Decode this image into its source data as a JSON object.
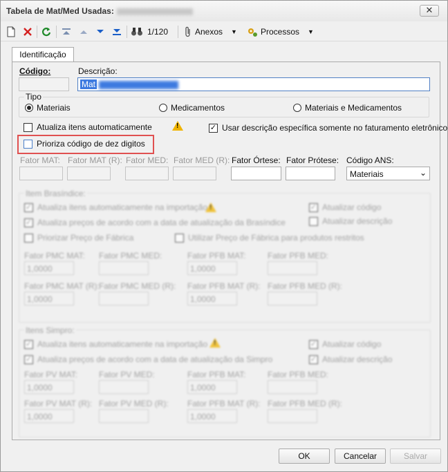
{
  "window": {
    "title": "Tabela de Mat/Med Usadas:",
    "close_glyph": "✕"
  },
  "toolbar": {
    "record_counter": "1/120",
    "anexos_label": "Anexos",
    "processos_label": "Processos",
    "icons": [
      "new-doc-icon",
      "delete-icon",
      "refresh-icon",
      "first-icon",
      "prev-icon",
      "next-icon",
      "last-icon",
      "binoculars-icon",
      "paperclip-icon",
      "gears-icon"
    ]
  },
  "tabs": [
    {
      "label": "Identificação"
    }
  ],
  "form": {
    "codigo_label": "Código:",
    "descricao_label": "Descrição:",
    "descricao_value": "Mat",
    "tipo": {
      "legend": "Tipo",
      "options": [
        "Materiais",
        "Medicamentos",
        "Materiais e Medicamentos"
      ],
      "selected": "Materiais"
    },
    "atualiza_label": "Atualiza itens automaticamente",
    "usar_descricao_label": "Usar descrição específica somente no faturamento eletrônico",
    "prioriza_label": "Prioriza código de dez digitos",
    "fator_labels": [
      "Fator MAT:",
      "Fator MAT (R):",
      "Fator MED:",
      "Fator MED (R):",
      "Fator Órtese:",
      "Fator Prótese:"
    ],
    "codigo_ans_label": "Código ANS:",
    "codigo_ans_value": "Materiais"
  },
  "brasindice": {
    "legend": "Item Brasíndice:",
    "opt1": "Atualiza itens automaticamente na importação",
    "opt2": "Atualiza preços de acordo com a data de atualização da Brasíndice",
    "opt3": "Priorizar Preço de Fábrica",
    "opt4": "Utilizar Preço de Fábrica para produtos restritos",
    "opt5": "Atualizar código",
    "opt6": "Atualizar descrição",
    "f1": "Fator PMC MAT:",
    "f2": "Fator PMC MED:",
    "f3": "Fator PFB MAT:",
    "f4": "Fator PFB MED:",
    "f5": "Fator PMC MAT (R):",
    "f6": "Fator PMC MED (R):",
    "f7": "Fator PFB MAT (R):",
    "f8": "Fator PFB MED (R):",
    "val": "1,0000"
  },
  "simpro": {
    "legend": "Itens Simpro:",
    "opt1": "Atualiza itens automaticamente na importação",
    "opt2": "Atualiza preços de acordo com a data de atualização da Simpro",
    "opt5": "Atualizar código",
    "opt6": "Atualizar descrição",
    "f1": "Fator PV MAT:",
    "f2": "Fator PV MED:",
    "f3": "Fator PFB MAT:",
    "f4": "Fator PFB MED:",
    "f5": "Fator PV MAT (R):",
    "f6": "Fator PV MED (R):",
    "f7": "Fator PFB MAT (R):",
    "f8": "Fator PFB MED (R):",
    "val": "1,0000"
  },
  "footer": {
    "ok_label": "OK",
    "cancelar_label": "Cancelar",
    "salvar_label": "Salvar"
  }
}
